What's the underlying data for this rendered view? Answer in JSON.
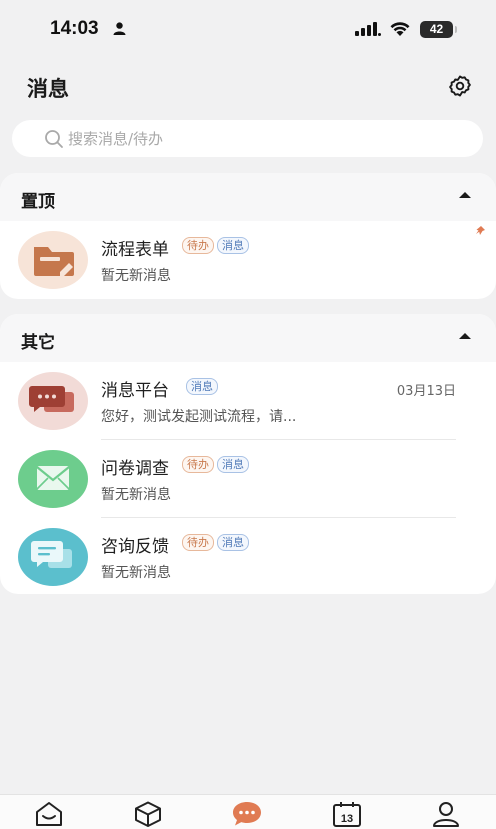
{
  "status_bar": {
    "time": "14:03",
    "battery": "42"
  },
  "header": {
    "title": "消息"
  },
  "search": {
    "placeholder": "搜索消息/待办"
  },
  "sections": {
    "pinned": {
      "title": "置顶",
      "items": [
        {
          "name": "流程表单",
          "tags": [
            "待办",
            "消息"
          ],
          "subtitle": "暂无新消息",
          "date": "",
          "icon": "folder-icon",
          "color": "#c97a4e"
        }
      ]
    },
    "others": {
      "title": "其它",
      "items": [
        {
          "name": "消息平台",
          "tags": [
            "消息"
          ],
          "subtitle": "您好，测试发起测试流程，请...",
          "date": "03月13日",
          "icon": "chat-bubbles-icon",
          "color": "#b65448"
        },
        {
          "name": "问卷调查",
          "tags": [
            "待办",
            "消息"
          ],
          "subtitle": "暂无新消息",
          "date": "",
          "icon": "envelope-icon",
          "color": "#6dcd8d"
        },
        {
          "name": "咨询反馈",
          "tags": [
            "待办",
            "消息"
          ],
          "subtitle": "暂无新消息",
          "date": "",
          "icon": "feedback-icon",
          "color": "#5bbfcd"
        }
      ]
    }
  },
  "tabbar": {
    "items": [
      {
        "name": "home-icon",
        "active": false
      },
      {
        "name": "box-icon",
        "active": false
      },
      {
        "name": "messages-icon",
        "active": true
      },
      {
        "name": "calendar-icon",
        "label": "13",
        "active": false
      },
      {
        "name": "profile-icon",
        "active": false
      }
    ],
    "accent": "#e07b53"
  }
}
